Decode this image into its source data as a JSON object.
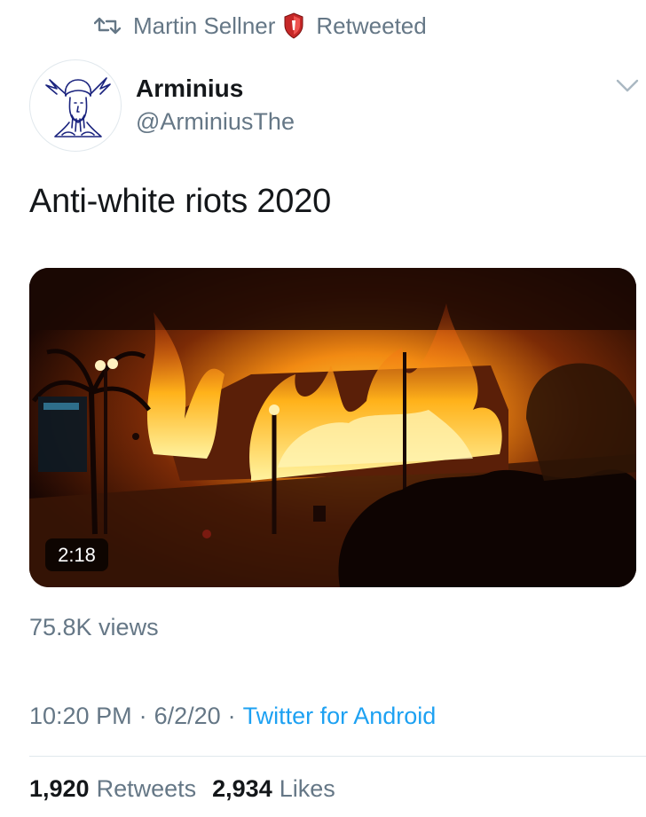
{
  "retweet_bar": {
    "retweeter": "Martin Sellner",
    "action": "Retweeted",
    "icons": [
      "retweet-icon",
      "shield-icon"
    ]
  },
  "author": {
    "display_name": "Arminius",
    "handle": "@ArminiusThe",
    "avatar_icon": "winged-helmet-head-avatar"
  },
  "tweet": {
    "text": "Anti-white riots 2020"
  },
  "media": {
    "type": "video",
    "duration": "2:18",
    "views": "75.8K views"
  },
  "meta": {
    "time": "10:20 PM",
    "separator": "·",
    "date": "6/2/20",
    "source": "Twitter for Android"
  },
  "stats": {
    "retweets_count": "1,920",
    "retweets_label": "Retweets",
    "likes_count": "2,934",
    "likes_label": "Likes"
  },
  "colors": {
    "secondary_text": "#657786",
    "link": "#1da1f2",
    "divider": "#e1e8ed"
  }
}
